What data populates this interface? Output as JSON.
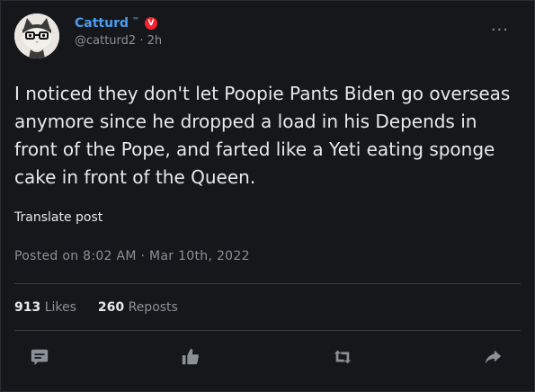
{
  "author": {
    "display_name": "Catturd",
    "trademark": "™",
    "verified_badge": "V",
    "handle": "@catturd2",
    "separator": "·",
    "age": "2h"
  },
  "post": {
    "text": "I noticed they don't let Poopie Pants Biden go overseas anymore since he dropped a load in his Depends in front of the Pope, and farted like a Yeti eating sponge cake in front of the Queen.",
    "translate_label": "Translate post",
    "posted_on": "Posted on 8:02 AM · Mar 10th, 2022"
  },
  "stats": {
    "likes_count": "913",
    "likes_label": "Likes",
    "reposts_count": "260",
    "reposts_label": "Reposts"
  },
  "colors": {
    "accent": "#4a9cf0",
    "badge": "#f4212e",
    "muted": "#8b8f96",
    "background": "#16171b"
  },
  "icons": [
    "reply-icon",
    "like-icon",
    "repost-icon",
    "share-icon",
    "more-icon"
  ]
}
